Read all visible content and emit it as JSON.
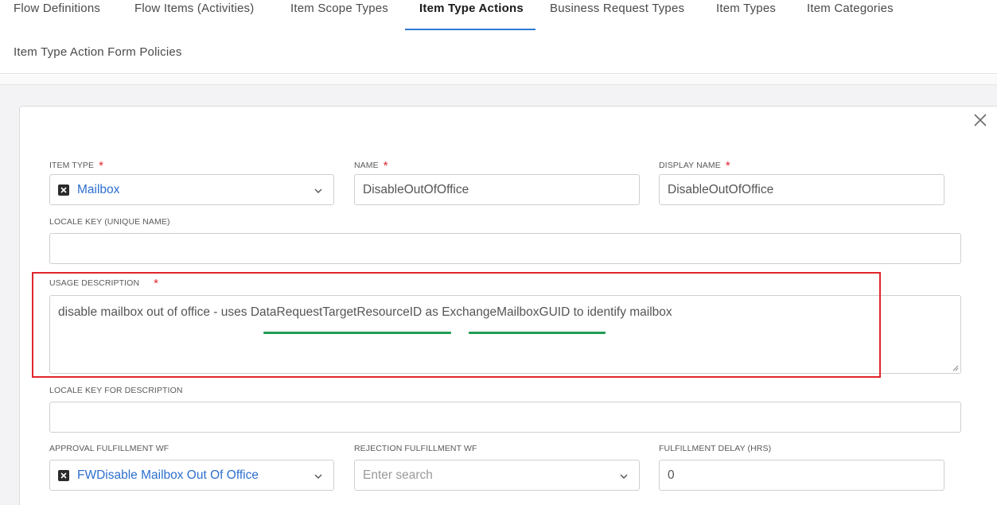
{
  "tabs": [
    {
      "label": "Flow Definitions"
    },
    {
      "label": "Flow Items (Activities)"
    },
    {
      "label": "Item Scope Types"
    },
    {
      "label": "Item Type Actions",
      "active": true
    },
    {
      "label": "Business Request Types"
    },
    {
      "label": "Item Types"
    },
    {
      "label": "Item Categories"
    },
    {
      "label": "Item Type Action Form Policies"
    }
  ],
  "form": {
    "item_type": {
      "label": "ITEM TYPE",
      "value": "Mailbox",
      "required": "*"
    },
    "name": {
      "label": "NAME",
      "value": "DisableOutOfOffice",
      "required": "*"
    },
    "display_name": {
      "label": "DISPLAY NAME",
      "value": "DisableOutOfOffice",
      "required": "*"
    },
    "locale_key": {
      "label": "LOCALE KEY (UNIQUE NAME)",
      "value": ""
    },
    "usage_description": {
      "label": "USAGE DESCRIPTION",
      "required": "*",
      "value": "disable mailbox out of office - uses DataRequestTargetResourceID as ExchangeMailboxGUID to identify mailbox"
    },
    "locale_key_description": {
      "label": "LOCALE KEY FOR DESCRIPTION",
      "value": ""
    },
    "approval_wf": {
      "label": "APPROVAL FULFILLMENT WF",
      "value": "FWDisable Mailbox Out Of Office"
    },
    "rejection_wf": {
      "label": "REJECTION FULFILLMENT WF",
      "placeholder": "Enter search"
    },
    "fulfillment_delay": {
      "label": "FULFILLMENT DELAY (HRS)",
      "value": "0"
    }
  },
  "colors": {
    "accent": "#2f7ad1",
    "required": "#e0252c",
    "highlight_box": "#e0252c",
    "underline": "#1f9d55",
    "select_value": "#2d6fcf"
  },
  "icons": [
    "close-icon",
    "clear-x-icon",
    "chevron-down-icon",
    "resize-grip-icon"
  ]
}
